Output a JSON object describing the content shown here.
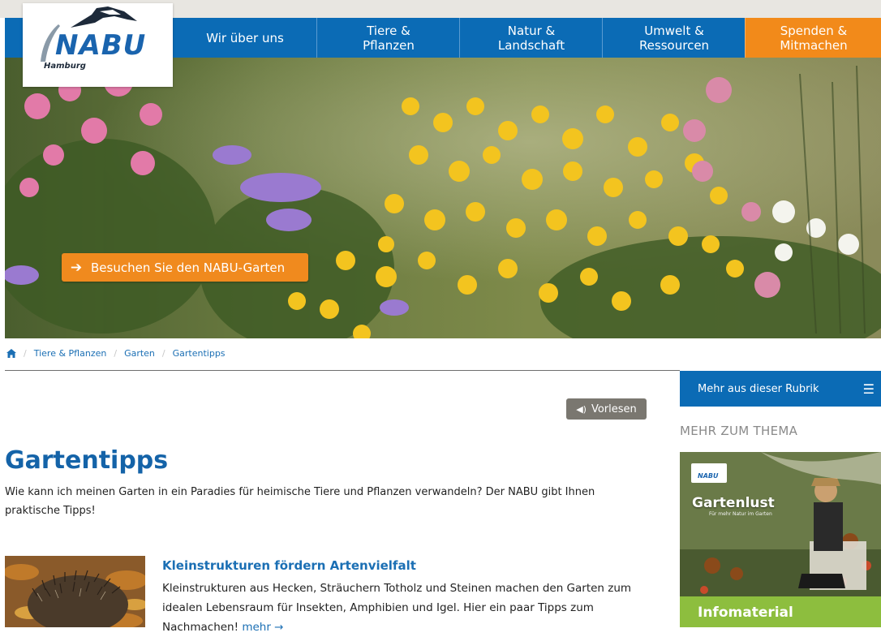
{
  "logo": {
    "name": "NABU",
    "region": "Hamburg",
    "icon": "stork-icon"
  },
  "nav": {
    "items": [
      {
        "line1": "Wir über uns",
        "line2": ""
      },
      {
        "line1": "Tiere &",
        "line2": "Pflanzen"
      },
      {
        "line1": "Natur &",
        "line2": "Landschaft"
      },
      {
        "line1": "Umwelt &",
        "line2": "Ressourcen"
      },
      {
        "line1": "Spenden &",
        "line2": "Mitmachen"
      }
    ],
    "highlight_color": "#f28a1a",
    "color": "#0b6bb5"
  },
  "hero": {
    "cta_label": "Besuchen Sie den NABU-Garten",
    "cta_icon": "arrow-right-icon"
  },
  "breadcrumb": {
    "home_icon": "home-icon",
    "items": [
      "Tiere & Pflanzen",
      "Garten",
      "Gartentipps"
    ]
  },
  "article": {
    "vorlesen_label": "Vorlesen",
    "vorlesen_icon": "speaker-icon",
    "title": "Gartentipps",
    "intro": "Wie kann ich meinen Garten in ein Paradies für heimische Tiere und Pflanzen verwandeln? Der NABU gibt Ihnen praktische Tipps!",
    "teaser": {
      "title": "Kleinstrukturen fördern Artenvielfalt",
      "text": "Kleinstrukturen aus Hecken, Sträuchern Totholz und Steinen machen den Garten zum idealen Lebensraum für Insekten, Amphibien und Igel. Hier ein paar Tipps zum Nachmachen!",
      "more_label": "mehr →",
      "image_icon": "hedgehog-image"
    }
  },
  "sidebar": {
    "rubrik_label": "Mehr aus dieser Rubrik",
    "rubrik_icon": "hamburger-menu-icon",
    "mehr_zum_thema": "MEHR ZUM THEMA",
    "promo": {
      "logo": "NABU",
      "title": "Gartenlust",
      "subtitle": "Für mehr Natur im Garten",
      "infomaterial_label": "Infomaterial"
    }
  }
}
